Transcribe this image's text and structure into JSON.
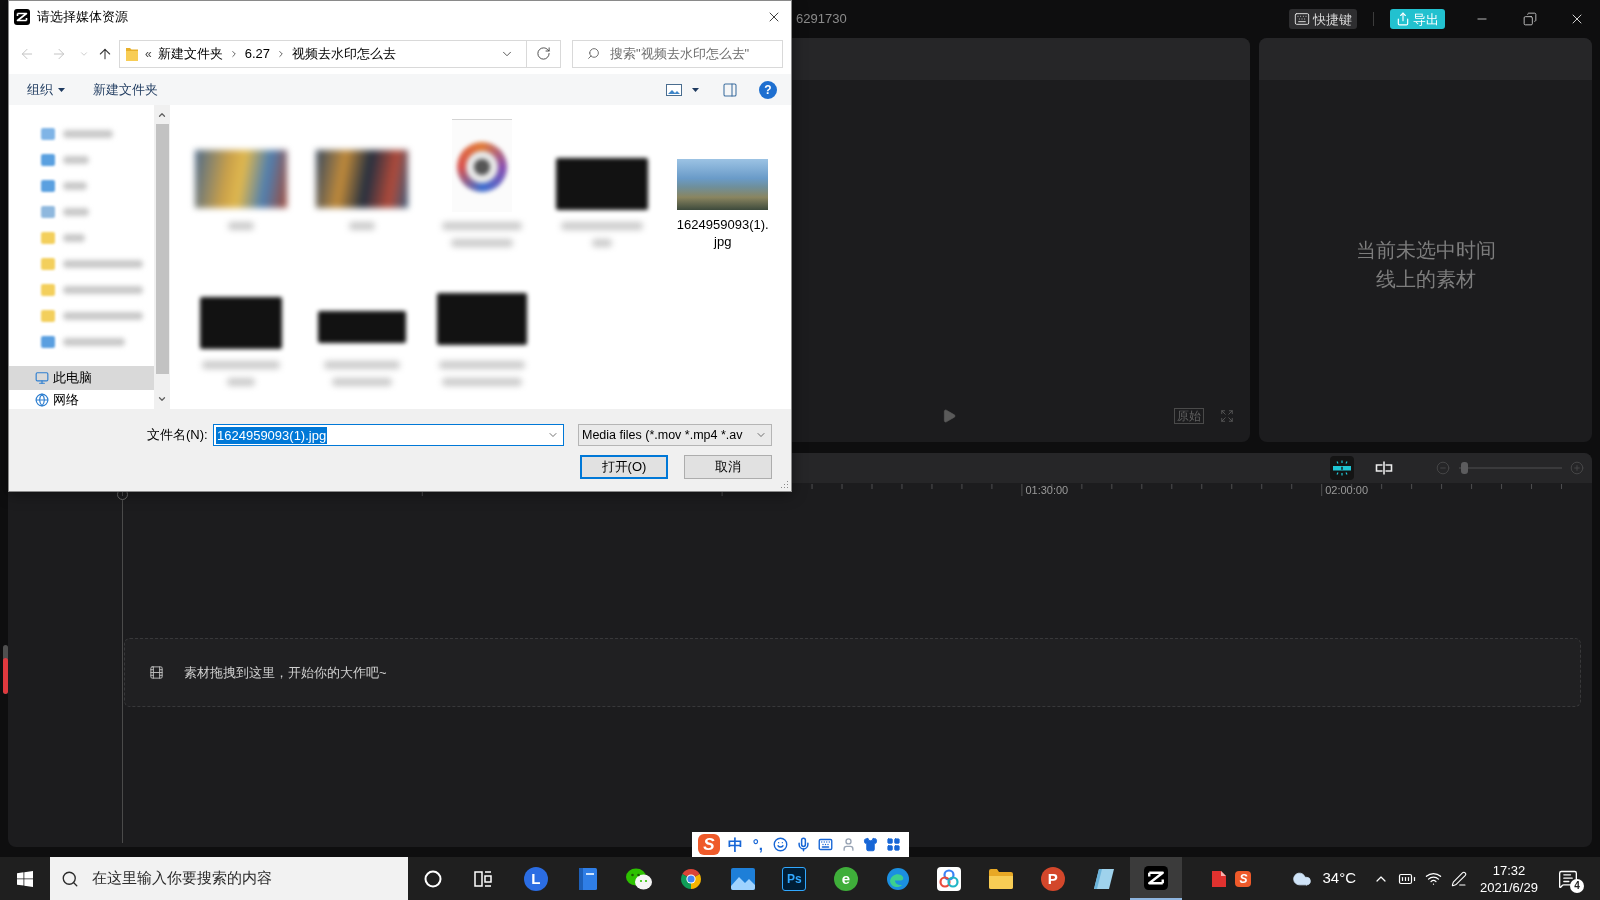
{
  "app": {
    "title": "6291730",
    "header_buttons": [
      {
        "kind": "shortcuts",
        "label": "快捷键"
      },
      {
        "kind": "export",
        "label": "导出"
      }
    ],
    "player": {
      "ratio_button": "原始"
    },
    "properties": {
      "empty_message": "当前未选中时间线上的素材"
    },
    "timeline": {
      "tools": [
        {
          "kind": "snap",
          "on": true
        },
        {
          "kind": "split",
          "on": false
        }
      ],
      "zoom": {
        "level": 0.02
      },
      "ruler": [
        {
          "label": "01:30:00"
        },
        {
          "label": "02:00:00"
        }
      ],
      "drop_hint": "素材拖拽到这里，开始你的大作吧~"
    },
    "side_meter": {
      "level": 0.73
    }
  },
  "dialog": {
    "title": "请选择媒体资源",
    "nav_buttons": [
      {
        "kind": "back",
        "disabled": true
      },
      {
        "kind": "forward",
        "disabled": true
      },
      {
        "kind": "recent",
        "disabled": true
      },
      {
        "kind": "up",
        "disabled": false
      }
    ],
    "address": {
      "overflow": "«",
      "path": [
        {
          "label": "新建文件夹"
        },
        {
          "label": "6.27"
        },
        {
          "label": "视频去水印怎么去"
        }
      ]
    },
    "search": {
      "placeholder": "搜索\"视频去水印怎么去\""
    },
    "commands": [
      {
        "label": "组织",
        "menu": true
      },
      {
        "label": "新建文件夹",
        "menu": false
      }
    ],
    "help": "?",
    "nav": [
      {
        "kind": "blurred",
        "color": "#7fb4e6",
        "selected": false
      },
      {
        "kind": "blurred",
        "color": "#5aa0e0",
        "selected": false
      },
      {
        "kind": "blurred",
        "color": "#5aa0e0",
        "selected": false
      },
      {
        "kind": "blurred",
        "color": "#8fb8de",
        "selected": false
      },
      {
        "kind": "blurred",
        "color": "#f3cf5c",
        "selected": false
      },
      {
        "kind": "blurred",
        "color": "#f3cf5c",
        "selected": false
      },
      {
        "kind": "blurred",
        "color": "#f3cf5c",
        "selected": false
      },
      {
        "kind": "blurred",
        "color": "#f3cf5c",
        "selected": false
      },
      {
        "kind": "blurred",
        "color": "#5a9fe0",
        "selected": false
      },
      {
        "kind": "computer",
        "label": "此电脑",
        "selected": true
      },
      {
        "kind": "network",
        "label": "网络",
        "selected": false
      }
    ],
    "files": [
      {
        "kind": "vivid"
      },
      {
        "kind": "vivid"
      },
      {
        "kind": "emblem"
      },
      {
        "kind": "dark"
      },
      {
        "kind": "photo",
        "name": "1624959093(1).jpg"
      },
      {
        "kind": "dark"
      },
      {
        "kind": "dark"
      },
      {
        "kind": "dark"
      }
    ],
    "filename": {
      "label": "文件名(N):",
      "value": "1624959093(1).jpg"
    },
    "filter": {
      "value": "Media files (*.mov *.mp4 *.av"
    },
    "buttons": [
      {
        "label": "打开(O)",
        "default": true
      },
      {
        "label": "取消",
        "default": false
      }
    ]
  },
  "ime_bar": {
    "items": [
      {
        "kind": "logo",
        "glyph": "S"
      },
      {
        "kind": "text",
        "label": "中"
      },
      {
        "kind": "text",
        "label": "°,"
      },
      {
        "kind": "emoji"
      },
      {
        "kind": "mic"
      },
      {
        "kind": "keyboard"
      },
      {
        "kind": "person"
      },
      {
        "kind": "shirt"
      },
      {
        "kind": "grid"
      }
    ]
  },
  "taskbar": {
    "search": {
      "placeholder": "在这里输入你要搜索的内容"
    },
    "apps": [
      {
        "kind": "letter",
        "glyph": "L",
        "color": "#2b6de3",
        "active": false
      },
      {
        "kind": "notebook",
        "active": false
      },
      {
        "kind": "chat",
        "active": false
      },
      {
        "kind": "browser",
        "active": false
      },
      {
        "kind": "picture",
        "active": false
      },
      {
        "kind": "tile",
        "glyph": "Ps",
        "color": "#31a8ff",
        "active": false
      },
      {
        "kind": "letter",
        "glyph": "e",
        "color": "#3fae3a",
        "active": false
      },
      {
        "kind": "swirl",
        "active": false
      },
      {
        "kind": "rings",
        "active": false
      },
      {
        "kind": "folder",
        "active": false
      },
      {
        "kind": "letter",
        "glyph": "P",
        "color": "#d3472b",
        "active": false
      },
      {
        "kind": "slate",
        "active": false
      },
      {
        "kind": "logo",
        "active": true
      }
    ],
    "tray_apps": [
      {
        "kind": "document"
      },
      {
        "kind": "logo",
        "glyph": "S"
      }
    ],
    "weather": "34°C",
    "time": "17:32",
    "date": "2021/6/29",
    "notifications": "4"
  }
}
